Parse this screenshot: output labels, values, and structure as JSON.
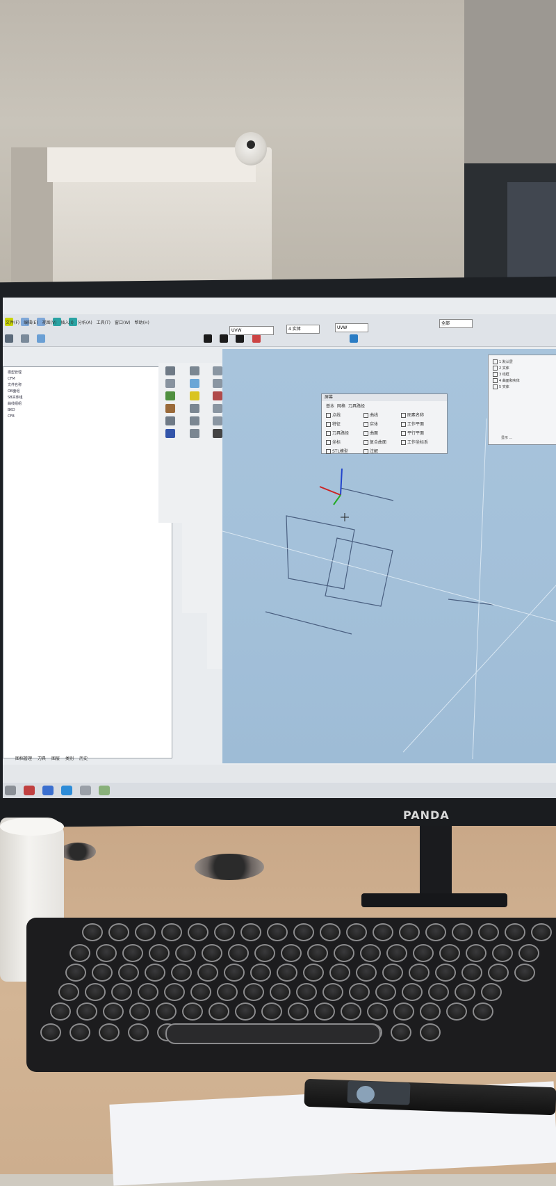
{
  "screen": {
    "menu": [
      "文件(F)",
      "编辑(E)",
      "视图(V)",
      "插入(I)",
      "分析(A)",
      "工具(T)",
      "窗口(W)",
      "帮助(H)"
    ],
    "toolbar": {
      "view_dropdown": "UVW",
      "shade_dropdown": "4 实体",
      "coord_dropdown": "UVW",
      "filter_dropdown": "全部"
    },
    "tree_panel": {
      "items": [
        "模型管理",
        "CFM",
        "文件名称",
        "OB面组",
        "SB实体组",
        "曲线组组",
        "BKD",
        "CFB"
      ],
      "tabs": [
        "图档管理",
        "刀具",
        "图层",
        "类别",
        "历史"
      ]
    },
    "dialog": {
      "title": "屏幕",
      "tabs": [
        "基本",
        "网格",
        "刀具路径"
      ],
      "options": [
        "点线",
        "曲线",
        "曲面",
        "图素名称",
        "特征",
        "实体",
        "工作平面",
        "刀具路径",
        "坐标",
        "平行平面",
        "注解",
        "复合曲面",
        "工作坐标系",
        "STL模型"
      ]
    },
    "layers": {
      "items": [
        "1 默认层",
        "2 实体",
        "3 线框",
        "4 曲面和实体",
        "5 实体"
      ],
      "footer": "显示 ..."
    }
  },
  "monitor": {
    "brand": "PANDA"
  },
  "colors": {
    "viewport_bg": "#a3c0d9",
    "bezel": "#1d2024",
    "desk": "#d3b595"
  }
}
